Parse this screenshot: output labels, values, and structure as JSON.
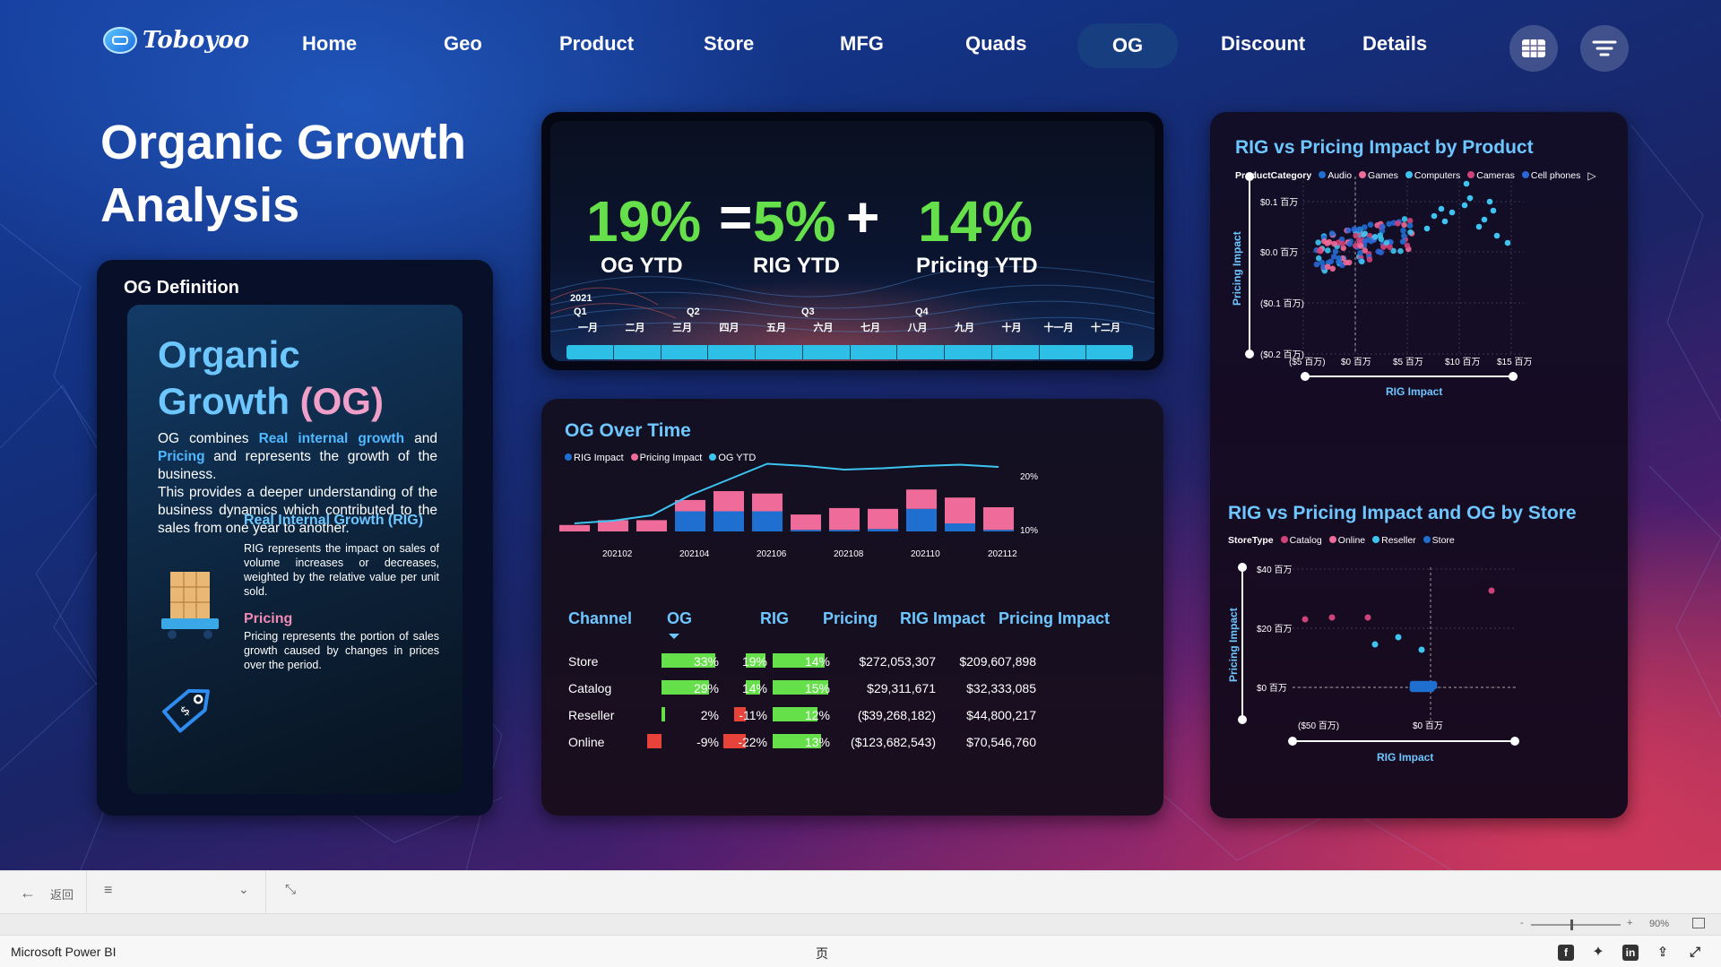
{
  "brand": {
    "name": "Toboyoo"
  },
  "nav": {
    "items": [
      "Home",
      "Geo",
      "Product",
      "Store",
      "MFG",
      "Quads",
      "OG",
      "Discount",
      "Details"
    ],
    "active": "OG",
    "icons": [
      "table-grid-icon",
      "filter-icon"
    ]
  },
  "page": {
    "title": "Organic Growth Analysis"
  },
  "og_definition": {
    "header": "OG Definition",
    "big_title_1": "Organic",
    "big_title_2a": "Growth",
    "big_title_2b": "(OG)",
    "desc_prefix": "OG combines",
    "desc_hl1": "Real internal growth",
    "desc_mid": "and",
    "desc_hl2": "Pricing",
    "desc_suffix": "and represents the growth of the business.",
    "desc_2": "This provides a deeper understanding of the business dynamics which contributed to the sales from one year to another.",
    "rig_title": "Real Internal Growth (RIG)",
    "rig_text": "RIG represents the impact on sales of volume increases or decreases, weighted by the relative value per unit sold.",
    "pricing_title": "Pricing",
    "pricing_text": "Pricing represents the portion of sales growth caused by changes in prices over the period."
  },
  "kpi": {
    "og_value": "19%",
    "og_label": "OG YTD",
    "equals": "=",
    "rig_value": "5%",
    "rig_label": "RIG YTD",
    "plus": "+",
    "pricing_value": "14%",
    "pricing_label": "Pricing YTD",
    "timeline": {
      "year": "2021",
      "quarters": [
        "Q1",
        "Q2",
        "Q3",
        "Q4"
      ],
      "months": [
        "一月",
        "二月",
        "三月",
        "四月",
        "五月",
        "六月",
        "七月",
        "八月",
        "九月",
        "十月",
        "十一月",
        "十二月"
      ]
    }
  },
  "og_over_time": {
    "title": "OG Over Time",
    "legend": [
      {
        "name": "RIG Impact",
        "color": "#1f6fd1"
      },
      {
        "name": "Pricing Impact",
        "color": "#ef6b99"
      },
      {
        "name": "OG YTD",
        "color": "#3ec4f0"
      }
    ],
    "y_right_ticks": [
      "20%",
      "10%"
    ],
    "x_ticks": [
      "202102",
      "202104",
      "202106",
      "202108",
      "202110",
      "202112"
    ]
  },
  "chart_data": [
    {
      "type": "bar",
      "name": "OG Over Time",
      "categories": [
        "202101",
        "202102",
        "202103",
        "202104",
        "202105",
        "202106",
        "202107",
        "202108",
        "202109",
        "202110",
        "202111",
        "202112"
      ],
      "series": [
        {
          "name": "RIG Impact",
          "values": [
            0,
            0,
            0,
            2.5,
            2.5,
            2.5,
            0.2,
            0.2,
            0.3,
            2.8,
            1.0,
            0.2
          ]
        },
        {
          "name": "Pricing Impact",
          "values": [
            0.8,
            1.4,
            1.4,
            1.4,
            2.5,
            2.2,
            1.9,
            2.7,
            2.5,
            2.4,
            3.2,
            2.8
          ]
        },
        {
          "name": "OG YTD",
          "values": [
            7.2,
            7.8,
            9.0,
            13.5,
            17.0,
            20.5,
            20.0,
            19.2,
            19.5,
            20.0,
            20.3,
            19.8
          ]
        }
      ],
      "y_right_ticks": [
        "20%",
        "10%"
      ]
    },
    {
      "type": "scatter",
      "name": "RIG vs Pricing Impact by Product",
      "title": "RIG vs Pricing Impact by Product",
      "xlabel": "RIG Impact",
      "ylabel": "Pricing Impact",
      "x_ticks": [
        "($5 百万)",
        "$0 百万",
        "$5 百万",
        "$10 百万",
        "$15 百万"
      ],
      "y_ticks": [
        "$0.1 百万",
        "$0.0 百万",
        "($0.1 百万)",
        "($0.2 百万)"
      ],
      "legend_title": "ProductCategory",
      "series": [
        {
          "name": "Audio",
          "color": "#1f6fd1"
        },
        {
          "name": "Games",
          "color": "#ef6b99"
        },
        {
          "name": "Computers",
          "color": "#3ec4f0"
        },
        {
          "name": "Cameras",
          "color": "#d0427a"
        },
        {
          "name": "Cell phones",
          "color": "#2a66d6"
        }
      ]
    },
    {
      "type": "scatter",
      "name": "RIG vs Pricing Impact and OG by Store",
      "title": "RIG vs Pricing Impact and OG by Store",
      "xlabel": "RIG Impact",
      "ylabel": "Pricing Impact",
      "x_ticks": [
        "($50 百万)",
        "$0 百万"
      ],
      "y_ticks": [
        "$40 百万",
        "$20 百万",
        "$0 百万"
      ],
      "legend_title": "StoreType",
      "series": [
        {
          "name": "Catalog",
          "color": "#d0427a"
        },
        {
          "name": "Online",
          "color": "#ef6b99"
        },
        {
          "name": "Reseller",
          "color": "#3ec4f0"
        },
        {
          "name": "Store",
          "color": "#1f6fd1"
        }
      ]
    }
  ],
  "channel_table": {
    "headers": [
      "Channel",
      "OG",
      "RIG",
      "Pricing",
      "RIG Impact",
      "Pricing Impact"
    ],
    "rows": [
      {
        "channel": "Store",
        "og": "33%",
        "og_v": 33,
        "rig": "19%",
        "rig_v": 19,
        "pricing": "14%",
        "pricing_v": 14,
        "rig_impact": "$272,053,307",
        "pricing_impact": "$209,607,898"
      },
      {
        "channel": "Catalog",
        "og": "29%",
        "og_v": 29,
        "rig": "14%",
        "rig_v": 14,
        "pricing": "15%",
        "pricing_v": 15,
        "rig_impact": "$29,311,671",
        "pricing_impact": "$32,333,085"
      },
      {
        "channel": "Reseller",
        "og": "2%",
        "og_v": 2,
        "rig": "-11%",
        "rig_v": -11,
        "pricing": "12%",
        "pricing_v": 12,
        "rig_impact": "($39,268,182)",
        "pricing_impact": "$44,800,217"
      },
      {
        "channel": "Online",
        "og": "-9%",
        "og_v": -9,
        "rig": "-22%",
        "rig_v": -22,
        "pricing": "13%",
        "pricing_v": 13,
        "rig_impact": "($123,682,543)",
        "pricing_impact": "$70,546,760"
      }
    ]
  },
  "toolbar": {
    "back": "返回",
    "zoom": "90%",
    "minus": "-",
    "plus": "+"
  },
  "footer": {
    "app": "Microsoft Power BI",
    "page": "页"
  },
  "colors": {
    "green": "#66e04a",
    "red": "#e8433a",
    "accent_blue": "#6ec6ff"
  }
}
